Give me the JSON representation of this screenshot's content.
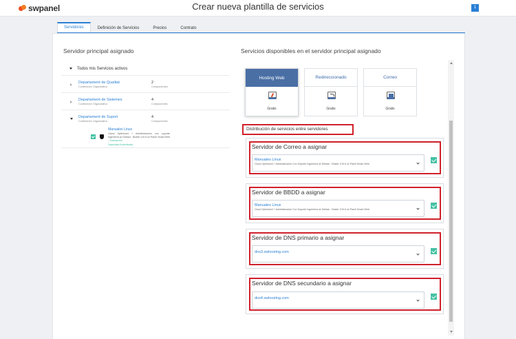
{
  "header": {
    "logo_text": "swpanel",
    "page_title": "Crear nueva plantilla de servicios",
    "user_badge": "1"
  },
  "tabs": [
    {
      "label": "Servidores",
      "active": true
    },
    {
      "label": "Definición de Servicios",
      "active": false
    },
    {
      "label": "Precios",
      "active": false
    },
    {
      "label": "Contrato",
      "active": false
    }
  ],
  "left": {
    "title": "Servidor principal asignado",
    "root_label": "Todos mis Servicios activos",
    "departments": [
      {
        "name": "Departament de Qualitat",
        "sub": "Contenedor Organizativo",
        "count": "2",
        "unit": "Componentes"
      },
      {
        "name": "Departament de Sistemes",
        "sub": "Contenedor Organizativo",
        "count": "4",
        "unit": "Componentes"
      },
      {
        "name": "Departament de Suport",
        "sub": "Contenedor Organizativo",
        "count": "4",
        "unit": "Componentes"
      }
    ],
    "service": {
      "name": "Manuales Linux",
      "desc": "Cloud Optimized + Administración con soporte ingeniería w/ Debian - Buster v10.6 w/ Panel Smart Web -",
      "status": "Suscripción",
      "auth": "Seguridad Autenticada"
    }
  },
  "right": {
    "title": "Servicios disponibles en el servidor principal asignado",
    "cards": [
      {
        "label": "Hosting Web",
        "foot": "Gratis",
        "icon": "html-file-icon"
      },
      {
        "label": "Redireccionado",
        "foot": "Gratis",
        "icon": "redirect-icon"
      },
      {
        "label": "Correo",
        "foot": "Gratis",
        "icon": "mail-icon"
      }
    ],
    "distribution_title": "Distribución de servicios entre servidores",
    "assignments": [
      {
        "title": "Servidor de Correo a asignar",
        "value": "Manuales Linux",
        "desc": "Cloud Optimized + Administración Con Soporte Ingeniería w/ Debian - Buster V10.6 w/ Panel Smart Web"
      },
      {
        "title": "Servidor de BBDD a asignar",
        "value": "Manuales Linux",
        "desc": "Cloud Optimized + Administración Con Soporte Ingeniería w/ Debian - Buster V10.6 w/ Panel Smart Web"
      },
      {
        "title": "Servidor de DNS primario a asignar",
        "value": "dns3.swhosting.com",
        "desc": ""
      },
      {
        "title": "Servidor de DNS secundario a asignar",
        "value": "dns4.swhosting.com",
        "desc": ""
      }
    ]
  }
}
